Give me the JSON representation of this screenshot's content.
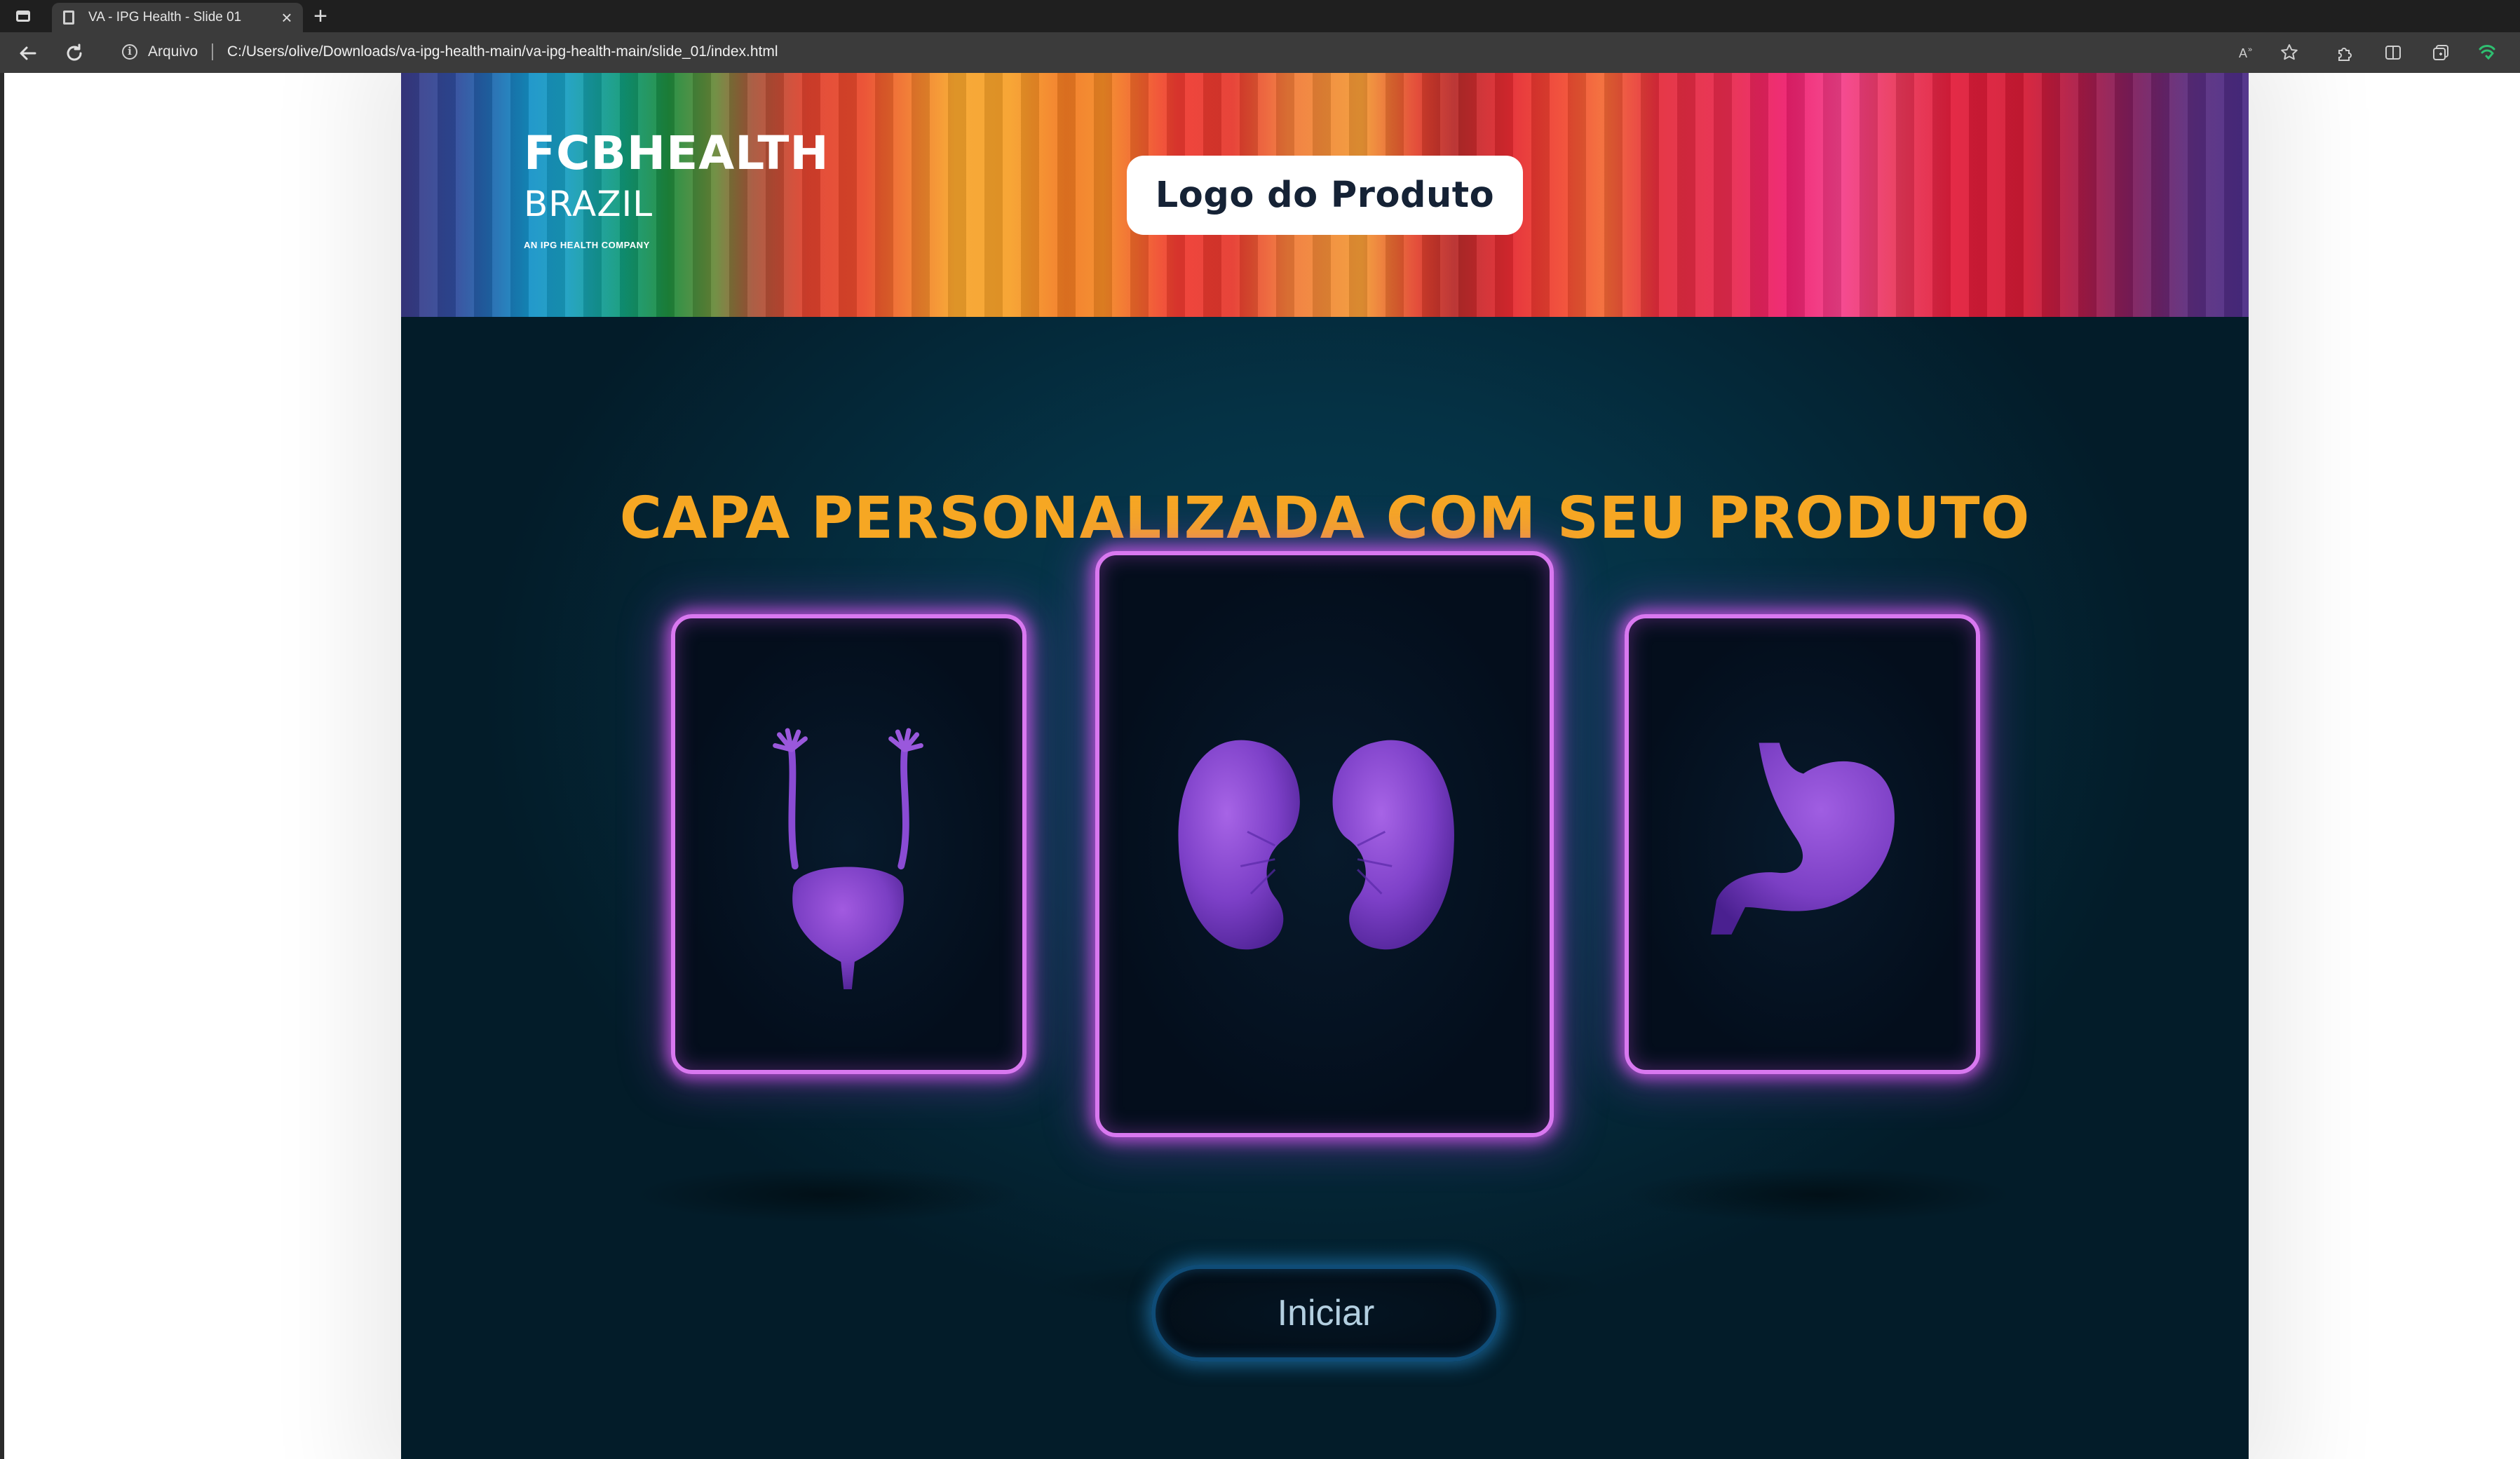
{
  "browser": {
    "tab_title": "VA - IPG Health - Slide 01",
    "tab_close_glyph": "×",
    "new_tab_glyph": "+",
    "address_prefix": "Arquivo",
    "url": "C:/Users/olive/Downloads/va-ipg-health-main/va-ipg-health-main/slide_01/index.html",
    "toolbar_icons": [
      "read-aloud-icon",
      "favorite-star-icon",
      "extensions-icon",
      "split-screen-icon",
      "collections-icon",
      "browser-essentials-icon"
    ]
  },
  "slide": {
    "brand": {
      "line1": "FCBHEALTH",
      "line2": "BRAZIL",
      "line3": "AN IPG HEALTH COMPANY"
    },
    "product_logo": "Logo do Produto",
    "title": "CAPA PERSONALIZADA COM SEU PRODUTO",
    "cards": [
      {
        "name": "bladder-card",
        "organ": "bladder"
      },
      {
        "name": "kidneys-card",
        "organ": "kidneys"
      },
      {
        "name": "stomach-card",
        "organ": "stomach"
      }
    ],
    "start_button": "Iniciar"
  },
  "colors": {
    "title": "#f6a723",
    "card_glow": "#d978f0",
    "organ": "#7b3fc4",
    "button_glow": "#1f8fd0",
    "slide_bg": "#053245"
  }
}
